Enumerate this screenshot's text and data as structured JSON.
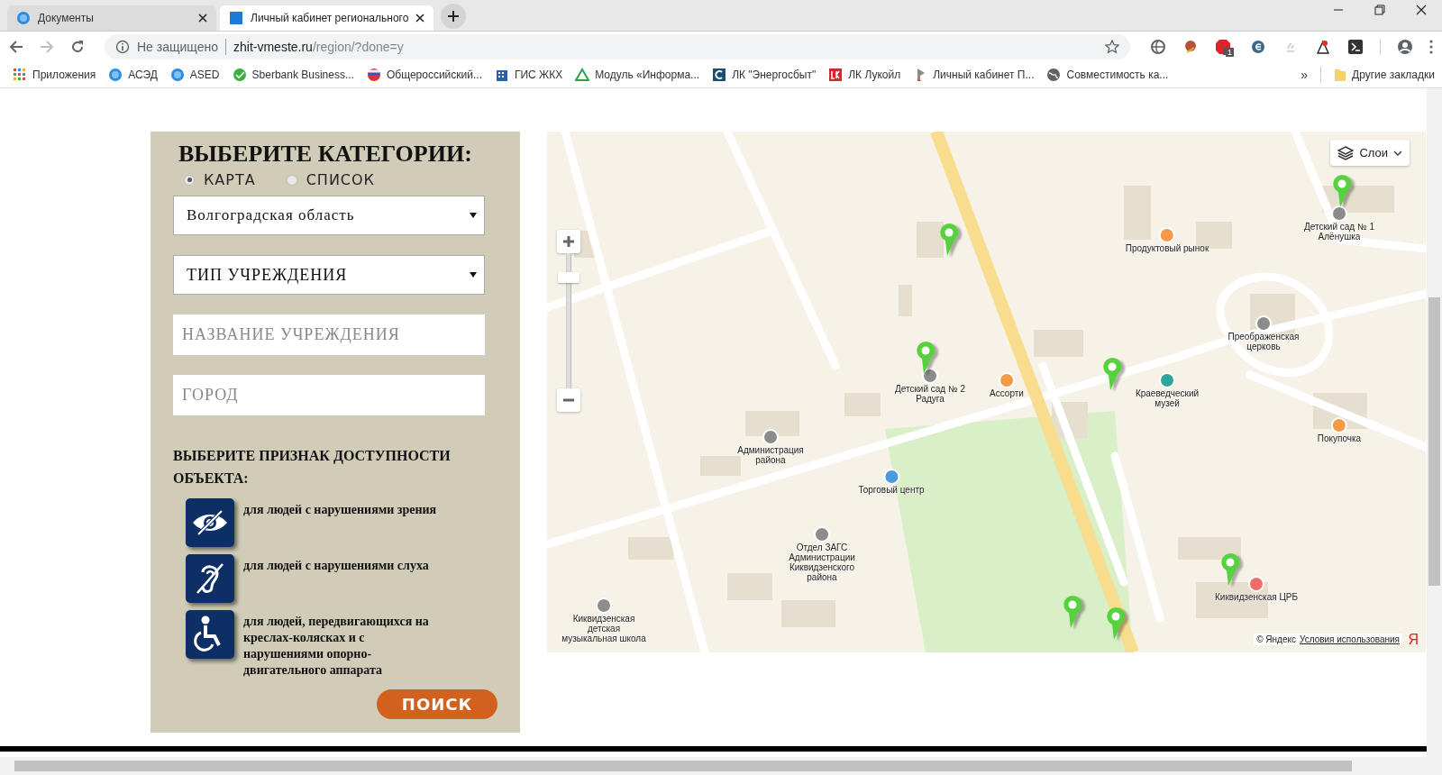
{
  "browser": {
    "tabs": [
      {
        "title": "Документы",
        "selected": false
      },
      {
        "title": "Личный кабинет регионального",
        "selected": true
      }
    ],
    "address": {
      "security": "Не защищено",
      "host": "zhit-vmeste.ru",
      "path": "/region/?done=y"
    },
    "bookmarks": [
      {
        "label": "Приложения",
        "kind": "apps"
      },
      {
        "label": "АСЭД",
        "kind": "dxl"
      },
      {
        "label": "ASED",
        "kind": "dxl"
      },
      {
        "label": "Sberbank Business...",
        "kind": "sber"
      },
      {
        "label": "Общероссийский...",
        "kind": "flag"
      },
      {
        "label": "ГИС ЖКХ",
        "kind": "building"
      },
      {
        "label": "Модуль «Информа...",
        "kind": "triangle"
      },
      {
        "label": "ЛК \"Энергосбыт\"",
        "kind": "energo"
      },
      {
        "label": "ЛК Лукойл",
        "kind": "lukoil"
      },
      {
        "label": "Личный кабинет П...",
        "kind": "pennant"
      },
      {
        "label": "Совместимость ка...",
        "kind": "globe"
      }
    ],
    "more": "»",
    "other_bookmarks": "Другие закладки",
    "adblock_count": "1"
  },
  "panel": {
    "title": "ВЫБЕРИТЕ КАТЕГОРИИ:",
    "views": [
      {
        "label": "КАРТА",
        "selected": true
      },
      {
        "label": "СПИСОК",
        "selected": false
      }
    ],
    "region_select": "Волгоградская область",
    "type_select": "ТИП УЧРЕЖДЕНИЯ",
    "name_field": {
      "placeholder": "НАЗВАНИЕ УЧРЕЖДЕНИЯ"
    },
    "city_field": {
      "placeholder": "ГОРОД"
    },
    "access_title": "ВЫБЕРИТЕ ПРИЗНАК ДОСТУПНОСТИ ОБЪЕКТА:",
    "access": [
      {
        "kind": "vision",
        "label": "для людей с нарушениями зрения"
      },
      {
        "kind": "hearing",
        "label": "для людей с нарушениями слуха"
      },
      {
        "kind": "wheelchair",
        "label": "для людей, передвигающихся на креслах-колясках и с нарушениями опорно-двигательного аппарата"
      }
    ],
    "search_button": "ПОИСК"
  },
  "map": {
    "layers_button": "Слои",
    "zoom": {
      "level": 0.86
    },
    "places": [
      {
        "name": "Детский сад № 1 Алёнушка",
        "color": "#8c8c8c"
      },
      {
        "name": "Продуктовый рынок",
        "color": "#f59a46"
      },
      {
        "name": "Преображенская церковь",
        "color": "#8c8c8c"
      },
      {
        "name": "Краеведческий музей",
        "color": "#2fa59a"
      },
      {
        "name": "Покупочка",
        "color": "#f59a46"
      },
      {
        "name": "Детский сад № 2 Радуга",
        "color": "#8c8c8c"
      },
      {
        "name": "Ассорти",
        "color": "#f59a46"
      },
      {
        "name": "Администрация района",
        "color": "#8c8c8c"
      },
      {
        "name": "Торговый центр",
        "color": "#4a9be0"
      },
      {
        "name": "Отдел ЗАГС Администрации Киквидзенского района",
        "color": "#8c8c8c"
      },
      {
        "name": "Киквидзенская детская музыкальная школа",
        "color": "#8c8c8c"
      },
      {
        "name": "Киквидзенская ЦРБ",
        "color": "#f26b6b"
      }
    ],
    "copyright": "© Яндекс",
    "terms_link": "Условия использования",
    "brand": "Я"
  }
}
